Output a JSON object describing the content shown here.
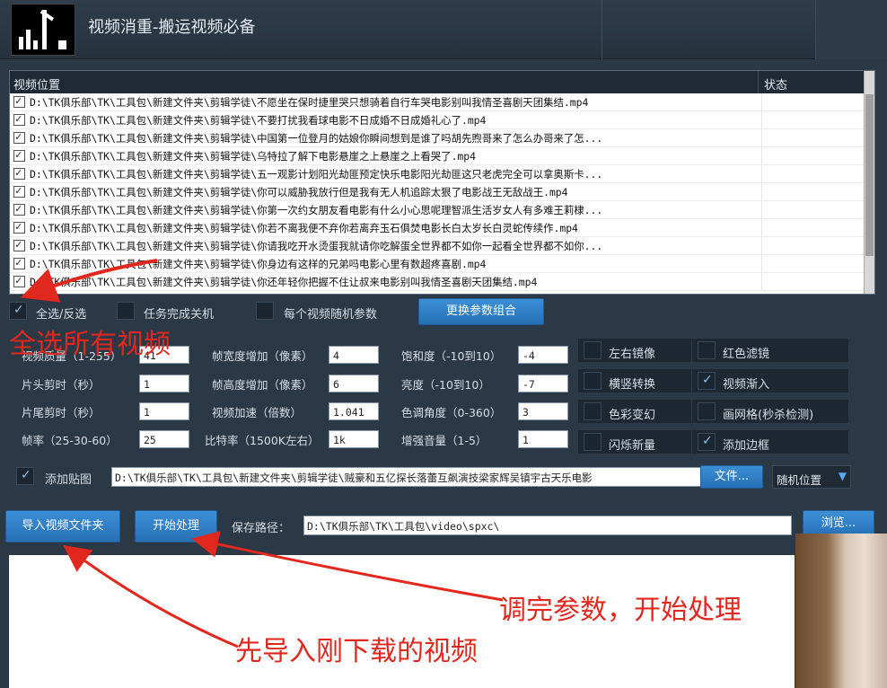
{
  "app": {
    "title": "视频消重-搬运视频必备"
  },
  "file_list": {
    "columns": [
      "视频位置",
      "状态"
    ],
    "rows": [
      "D:\\TK俱乐部\\TK\\工具包\\新建文件夹\\剪辑学徒\\不愿坐在保时捷里哭只想骑着自行车哭电影别叫我情圣喜剧天团集结.mp4",
      "D:\\TK俱乐部\\TK\\工具包\\新建文件夹\\剪辑学徒\\不要打扰我看球电影不日成婚不日成婚礼心了.mp4",
      "D:\\TK俱乐部\\TK\\工具包\\新建文件夹\\剪辑学徒\\中国第一位登月的姑娘你瞬间想到是谁了吗胡先煦哥来了怎么办哥来了怎...",
      "D:\\TK俱乐部\\TK\\工具包\\新建文件夹\\剪辑学徒\\乌特拉了解下电影悬崖之上悬崖之上看哭了.mp4",
      "D:\\TK俱乐部\\TK\\工具包\\新建文件夹\\剪辑学徒\\五一观影计划阳光劫匪预定快乐电影阳光劫匪这只老虎完全可以拿奥斯卡...",
      "D:\\TK俱乐部\\TK\\工具包\\新建文件夹\\剪辑学徒\\你可以威胁我放行但是我有无人机追踪太狠了电影战王无敌战王.mp4",
      "D:\\TK俱乐部\\TK\\工具包\\新建文件夹\\剪辑学徒\\你第一次约女朋友看电影有什么小心思呢理智派生活岁女人有多难王莉棣...",
      "D:\\TK俱乐部\\TK\\工具包\\新建文件夹\\剪辑学徒\\你若不离我便不弃你若离弃玉石俱焚电影长白太岁长白灵蛇传续作.mp4",
      "D:\\TK俱乐部\\TK\\工具包\\新建文件夹\\剪辑学徒\\你请我吃开水烫蛋我就请你吃解蛋全世界都不如你一起看全世界都不如你...",
      "D:\\TK俱乐部\\TK\\工具包\\新建文件夹\\剪辑学徒\\你身边有这样的兄弟吗电影心里有数超疼喜剧.mp4",
      "D:\\TK俱乐部\\TK\\工具包\\新建文件夹\\剪辑学徒\\你还年轻你把握不住让叔来电影别叫我情圣喜剧天团集结.mp4"
    ]
  },
  "toolbar": {
    "select_all": "全选/反选",
    "shutdown": "任务完成关机",
    "random_params": "每个视频随机参数",
    "change_params_btn": "更换参数组合"
  },
  "params": {
    "quality_label": "视频质量（1-255）",
    "quality": "41",
    "head_cut_label": "片头剪时（秒）",
    "head_cut": "1",
    "tail_cut_label": "片尾剪时（秒）",
    "tail_cut": "1",
    "fps_label": "帧率（25-30-60）",
    "fps": "25",
    "width_label": "帧宽度增加（像素）",
    "width_add": "4",
    "height_label": "帧高度增加（像素）",
    "height_add": "6",
    "speed_label": "视频加速（倍数）",
    "speed": "1.041",
    "bitrate_label": "比特率（1500K左右）",
    "bitrate": "1k",
    "saturation_label": "饱和度（-10到10）",
    "saturation": "-4",
    "brightness_label": "亮度（-10到10）",
    "brightness": "-7",
    "hue_label": "色调角度（0-360）",
    "hue": "3",
    "volume_label": "增强音量（1-5）",
    "volume": "1"
  },
  "options": [
    {
      "label": "左右镜像",
      "checked": false
    },
    {
      "label": "红色滤镜",
      "checked": false
    },
    {
      "label": "横竖转换",
      "checked": false
    },
    {
      "label": "视频渐入",
      "checked": true
    },
    {
      "label": "色彩变幻",
      "checked": false
    },
    {
      "label": "画网格(秒杀检测)",
      "checked": false
    },
    {
      "label": "闪烁新量",
      "checked": false
    },
    {
      "label": "添加边框",
      "checked": true
    }
  ],
  "sticker": {
    "label": "添加贴图",
    "path": "D:\\TK俱乐部\\TK\\工具包\\新建文件夹\\剪辑学徒\\贼豪和五亿探长落蕾互飙演技梁家辉吴镇宇古天乐电影",
    "file_btn": "文件...",
    "position": "随机位置"
  },
  "actions": {
    "import_btn": "导入视频文件夹",
    "start_btn": "开始处理",
    "save_label": "保存路径：",
    "save_path": "D:\\TK俱乐部\\TK\\工具包\\video\\spxc\\",
    "browse_btn": "浏览..."
  },
  "annotations": {
    "select_all_note": "全选所有视频",
    "params_note": "调完参数，开始处理",
    "import_note": "先导入刚下载的视频"
  },
  "colors": {
    "annotation": "#e0281e",
    "button": "#2f7cc4",
    "background": "#2b3845"
  }
}
